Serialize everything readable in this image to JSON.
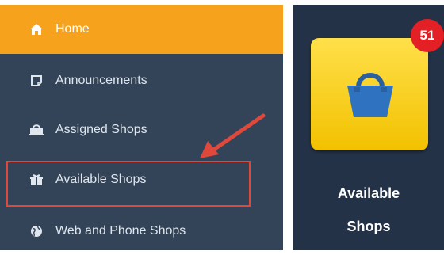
{
  "sidebar": {
    "items": [
      {
        "label": "Home",
        "icon": "home-icon",
        "active": true
      },
      {
        "label": "Announcements",
        "icon": "note-icon"
      },
      {
        "label": "Assigned Shops",
        "icon": "shopping-bag-icon"
      },
      {
        "label": "Available Shops",
        "icon": "gift-icon",
        "highlighted": true
      },
      {
        "label": "Web and Phone Shops",
        "icon": "globe-icon"
      }
    ]
  },
  "tile": {
    "label_line1": "Available",
    "label_line2": "Shops",
    "badge_count": "51",
    "icon": "shopping-basket-icon"
  },
  "colors": {
    "sidebar_bg": "#344458",
    "active_bg": "#f7a21c",
    "highlight": "#e0483c",
    "tile_bg": "#f2c100",
    "badge_bg": "#e32025"
  }
}
